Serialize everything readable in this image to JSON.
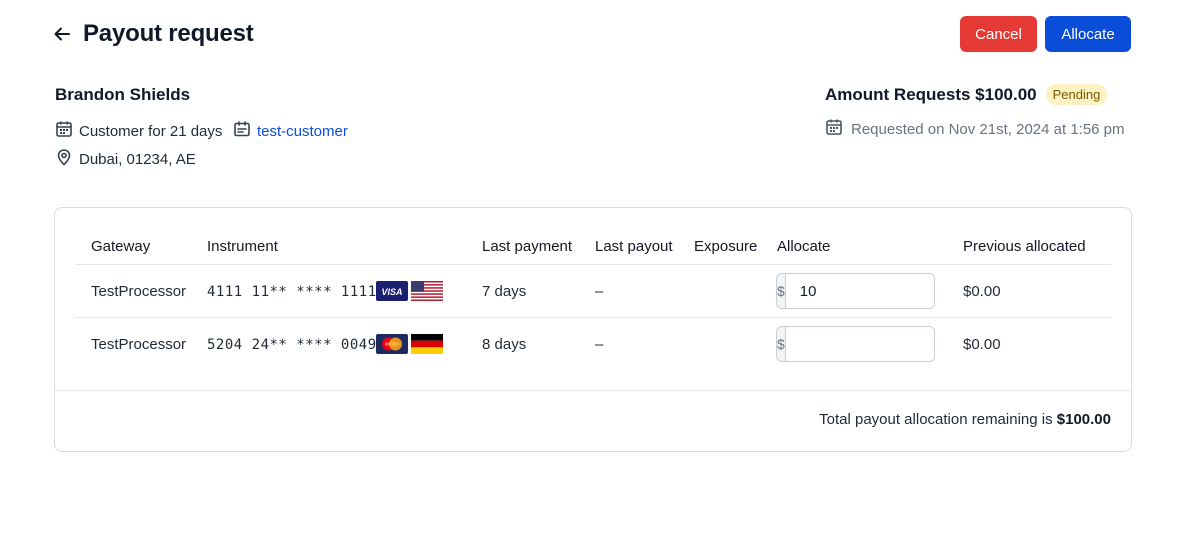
{
  "header": {
    "title": "Payout request",
    "cancel_label": "Cancel",
    "allocate_label": "Allocate"
  },
  "customer": {
    "name": "Brandon Shields",
    "since": "Customer for 21 days",
    "link": "test-customer",
    "location": "Dubai, 01234, AE"
  },
  "request": {
    "amount_title": "Amount Requests $100.00",
    "status": "Pending",
    "requested_on": "Requested on Nov 21st, 2024 at 1:56 pm"
  },
  "table": {
    "columns": [
      "Gateway",
      "Instrument",
      "Last payment",
      "Last payout",
      "Exposure",
      "Allocate",
      "Previous allocated"
    ],
    "currency_symbol": "$",
    "rows": [
      {
        "gateway": "TestProcessor",
        "instrument": "4111 11** **** 1111",
        "card_brand": "visa",
        "card_brand_label": "VISA",
        "country_flag": "us-flag",
        "last_payment": "7 days",
        "last_payout": "–",
        "exposure": "",
        "allocate_value": "10",
        "previous_allocated": "$0.00"
      },
      {
        "gateway": "TestProcessor",
        "instrument": "5204 24** **** 0049",
        "card_brand": "mastercard",
        "card_brand_label": "MasterCard",
        "country_flag": "de-flag",
        "last_payment": "8 days",
        "last_payout": "–",
        "exposure": "",
        "allocate_value": "",
        "previous_allocated": "$0.00"
      }
    ],
    "footer_prefix": "Total payout allocation remaining is ",
    "footer_amount": "$100.00"
  },
  "colors": {
    "cancel": "#e53935",
    "primary": "#0a4dd8",
    "link": "#0a4dd8",
    "pending_bg": "#fdf2c4",
    "visa": "#1a1f71",
    "mastercard_bg": "#1d2b5e"
  }
}
